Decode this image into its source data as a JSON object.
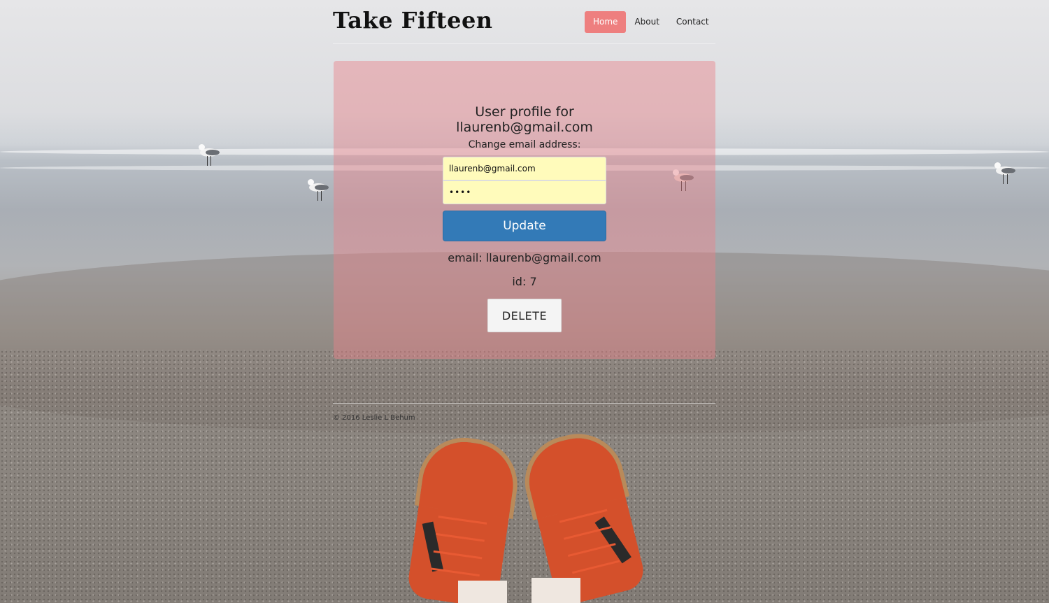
{
  "site": {
    "title": "Take Fifteen"
  },
  "nav": {
    "items": [
      {
        "label": "Home",
        "active": true
      },
      {
        "label": "About",
        "active": false
      },
      {
        "label": "Contact",
        "active": false
      }
    ]
  },
  "profile": {
    "heading_line1": "User profile for",
    "heading_line2": "llaurenb@gmail.com",
    "change_label": "Change email address:",
    "email_value": "llaurenb@gmail.com",
    "password_value": "••••",
    "update_label": "Update",
    "email_line": "email: llaurenb@gmail.com",
    "id_line": "id: 7",
    "delete_label": "DELETE"
  },
  "footer": {
    "text": "© 2016 Leslie L Behum"
  },
  "colors": {
    "nav_active": "#ee7f7f",
    "panel": "rgba(232,130,138,0.45)",
    "update_button": "#337ab7",
    "input_bg": "#fffbbb"
  }
}
